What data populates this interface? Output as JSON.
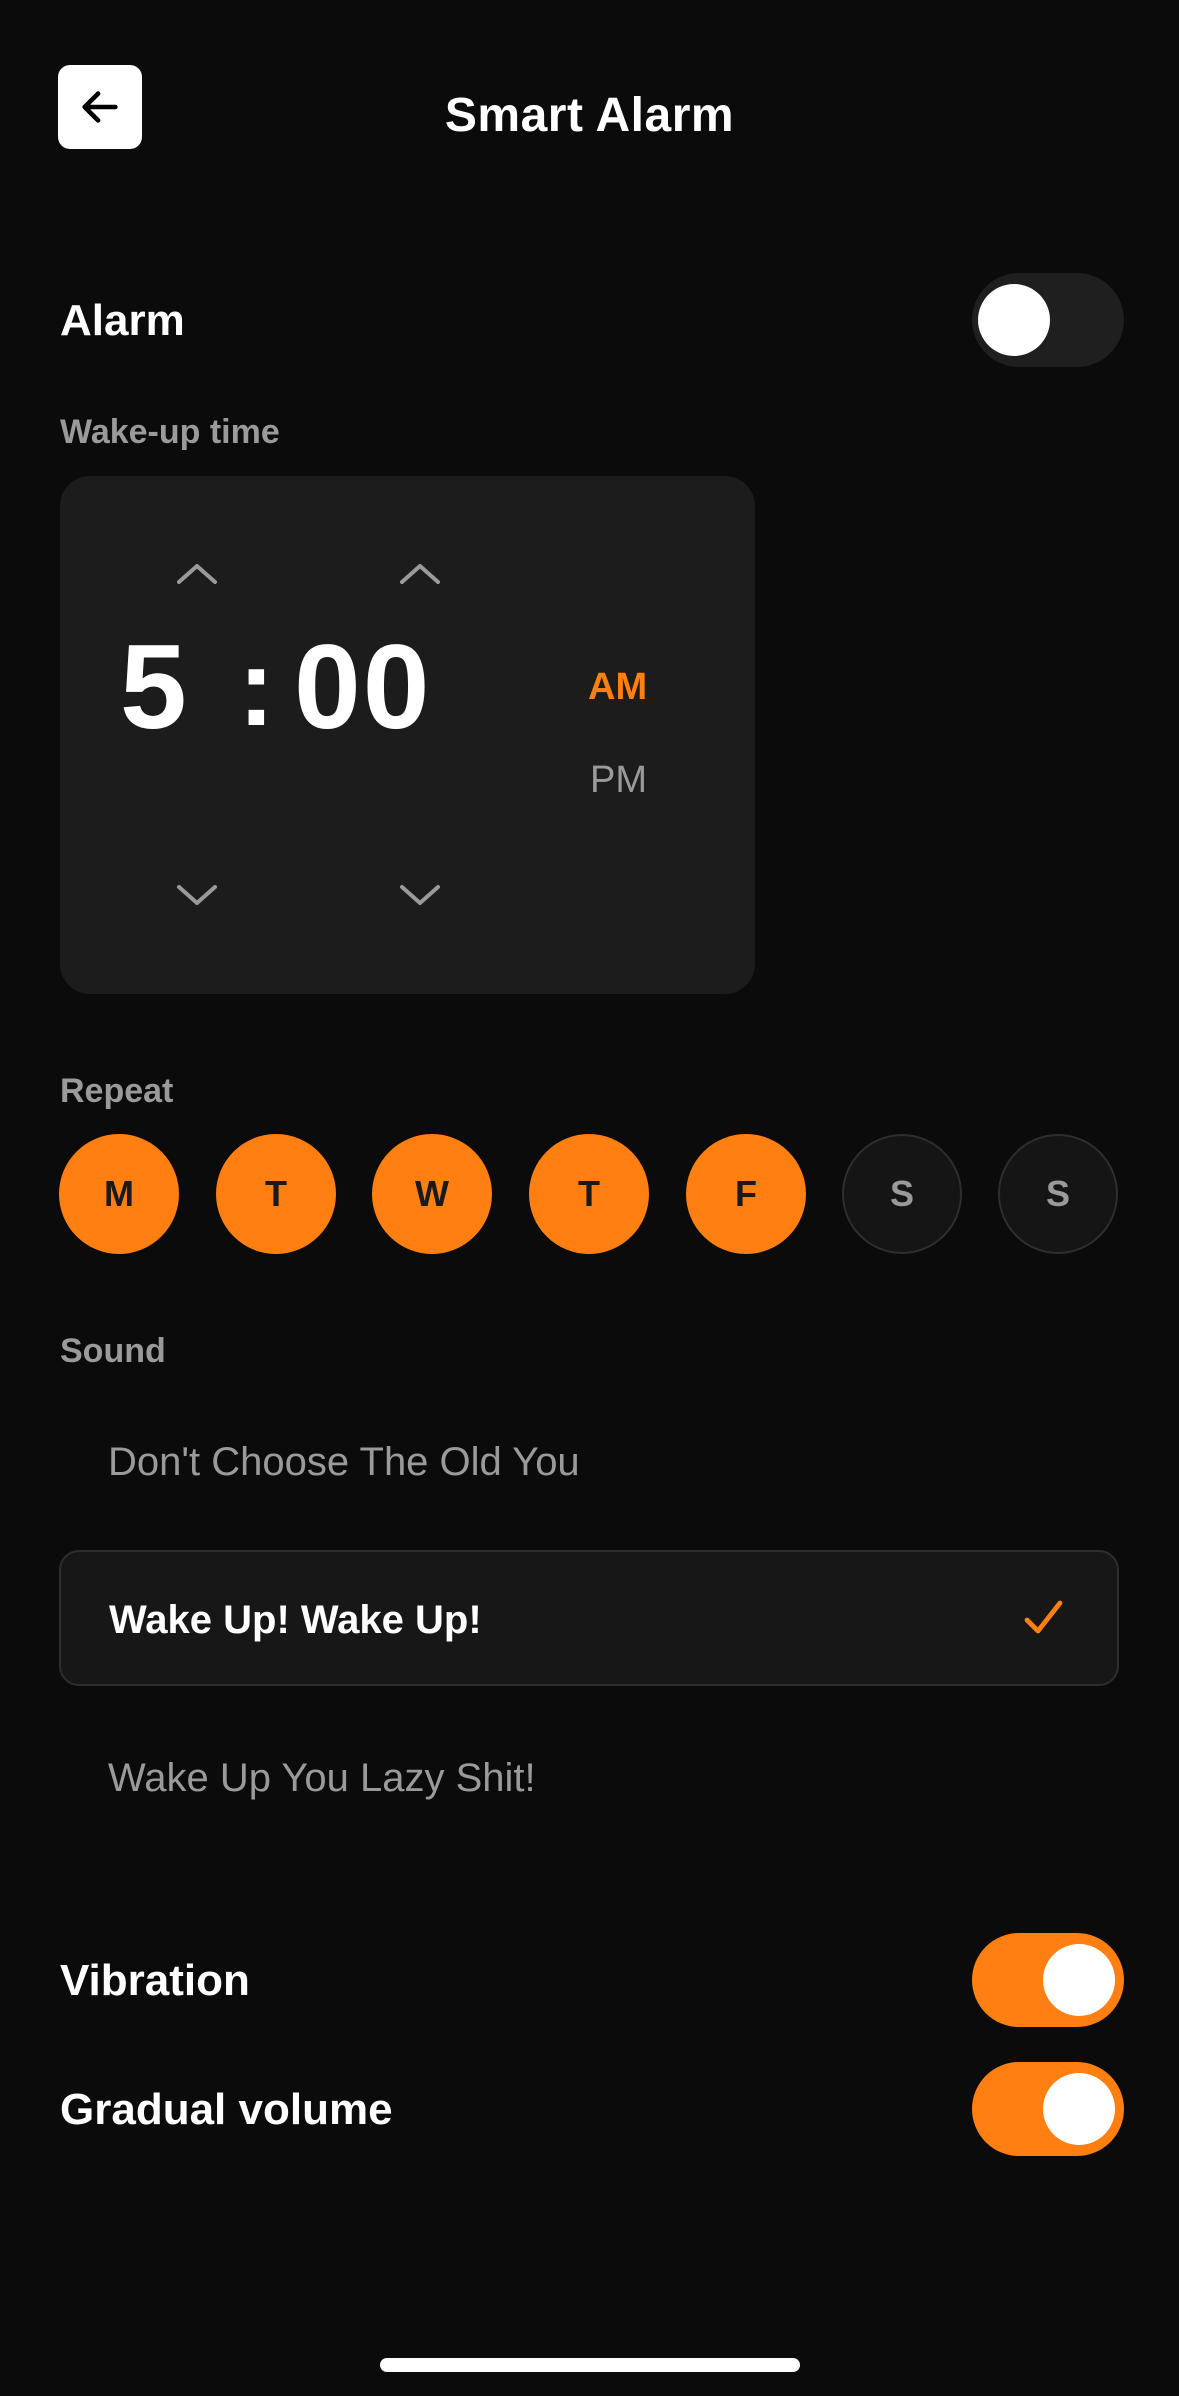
{
  "header": {
    "title": "Smart Alarm",
    "back_icon": "arrow-left-icon"
  },
  "alarm": {
    "label": "Alarm",
    "enabled": false
  },
  "wake_up": {
    "label": "Wake-up time",
    "hour": "5",
    "separator": ":",
    "minute": "00",
    "am": "AM",
    "pm": "PM",
    "selected_period": "AM"
  },
  "repeat": {
    "label": "Repeat",
    "days": [
      {
        "label": "M",
        "on": true
      },
      {
        "label": "T",
        "on": true
      },
      {
        "label": "W",
        "on": true
      },
      {
        "label": "T",
        "on": true
      },
      {
        "label": "F",
        "on": true
      },
      {
        "label": "S",
        "on": false
      },
      {
        "label": "S",
        "on": false
      }
    ]
  },
  "sound": {
    "label": "Sound",
    "options": [
      {
        "label": "Don't Choose The Old You",
        "selected": false
      },
      {
        "label": "Wake Up! Wake Up!",
        "selected": true
      },
      {
        "label": "Wake Up You Lazy Shit!",
        "selected": false
      }
    ]
  },
  "vibration": {
    "label": "Vibration",
    "enabled": true
  },
  "gradual_volume": {
    "label": "Gradual volume",
    "enabled": true
  },
  "colors": {
    "accent": "#ff7f11",
    "background": "#0b0b0b",
    "card": "#1c1c1c",
    "muted": "#9a9a9a"
  }
}
